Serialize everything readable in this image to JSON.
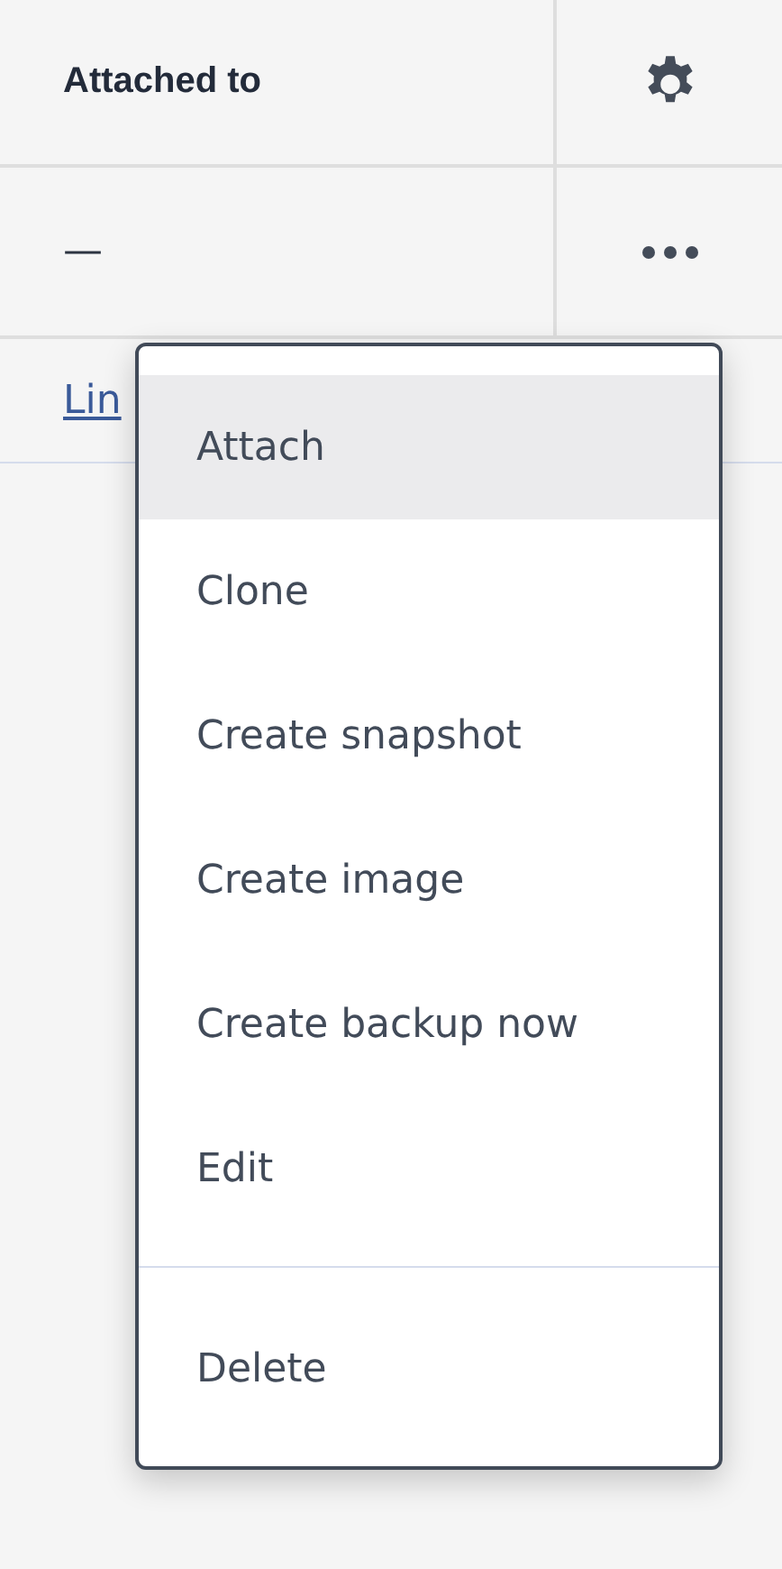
{
  "table": {
    "header": {
      "label": "Attached to"
    },
    "rows": [
      {
        "attached_to": "—"
      }
    ],
    "link_row": {
      "link": "Lin"
    }
  },
  "menu": {
    "sections": [
      {
        "items": [
          {
            "label": "Attach",
            "highlighted": true
          },
          {
            "label": "Clone",
            "highlighted": false
          },
          {
            "label": "Create snapshot",
            "highlighted": false
          },
          {
            "label": "Create image",
            "highlighted": false
          },
          {
            "label": "Create backup now",
            "highlighted": false
          },
          {
            "label": "Edit",
            "highlighted": false
          }
        ]
      },
      {
        "items": [
          {
            "label": "Delete",
            "highlighted": false
          }
        ]
      }
    ]
  }
}
